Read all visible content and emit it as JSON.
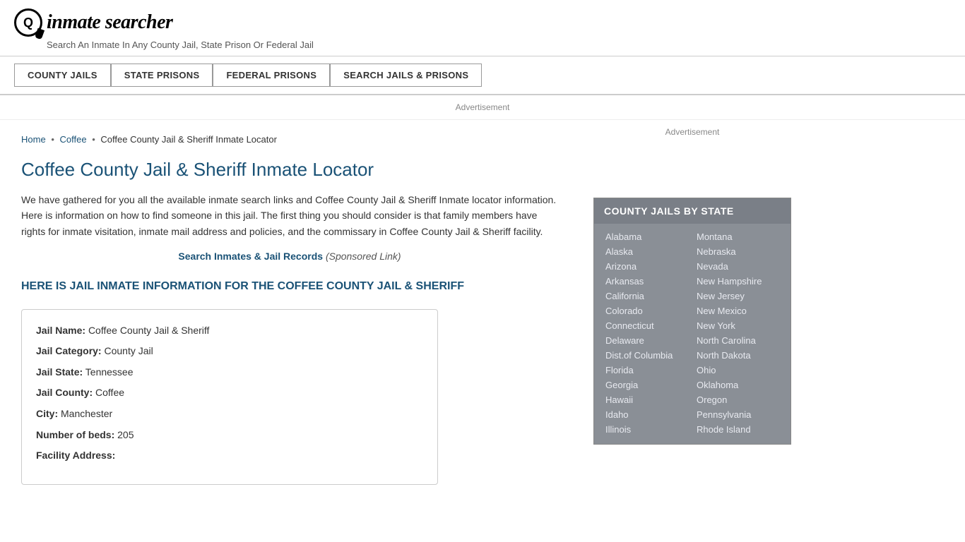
{
  "header": {
    "logo_symbol": "Q",
    "logo_text_part1": "inmate",
    "logo_text_part2": "searcher",
    "tagline": "Search An Inmate In Any County Jail, State Prison Or Federal Jail"
  },
  "nav": {
    "buttons": [
      {
        "id": "county-jails",
        "label": "COUNTY JAILS"
      },
      {
        "id": "state-prisons",
        "label": "STATE PRISONS"
      },
      {
        "id": "federal-prisons",
        "label": "FEDERAL PRISONS"
      },
      {
        "id": "search-jails",
        "label": "SEARCH JAILS & PRISONS"
      }
    ]
  },
  "ad_bar_label": "Advertisement",
  "breadcrumb": {
    "home_label": "Home",
    "coffee_label": "Coffee",
    "current": "Coffee County Jail & Sheriff Inmate Locator"
  },
  "page_title": "Coffee County Jail & Sheriff Inmate Locator",
  "description": "We have gathered for you all the available inmate search links and Coffee County Jail & Sheriff Inmate locator information. Here is information on how to find someone in this jail. The first thing you should consider is that family members have rights for inmate visitation, inmate mail address and policies, and the commissary in Coffee County Jail & Sheriff facility.",
  "sponsored": {
    "link_text": "Search Inmates & Jail Records",
    "suffix": "(Sponsored Link)"
  },
  "section_heading": "HERE IS JAIL INMATE INFORMATION FOR THE COFFEE COUNTY JAIL & SHERIFF",
  "info_box": {
    "fields": [
      {
        "label": "Jail Name:",
        "value": "Coffee County Jail & Sheriff"
      },
      {
        "label": "Jail Category:",
        "value": "County Jail"
      },
      {
        "label": "Jail State:",
        "value": "Tennessee"
      },
      {
        "label": "Jail County:",
        "value": "Coffee"
      },
      {
        "label": "City:",
        "value": "Manchester"
      },
      {
        "label": "Number of beds:",
        "value": "205"
      },
      {
        "label": "Facility Address:",
        "value": ""
      }
    ]
  },
  "sidebar": {
    "ad_label": "Advertisement",
    "state_box": {
      "title": "COUNTY JAILS BY STATE",
      "states_col1": [
        "Alabama",
        "Alaska",
        "Arizona",
        "Arkansas",
        "California",
        "Colorado",
        "Connecticut",
        "Delaware",
        "Dist.of Columbia",
        "Florida",
        "Georgia",
        "Hawaii",
        "Idaho",
        "Illinois"
      ],
      "states_col2": [
        "Montana",
        "Nebraska",
        "Nevada",
        "New Hampshire",
        "New Jersey",
        "New Mexico",
        "New York",
        "North Carolina",
        "North Dakota",
        "Ohio",
        "Oklahoma",
        "Oregon",
        "Pennsylvania",
        "Rhode Island"
      ]
    }
  }
}
